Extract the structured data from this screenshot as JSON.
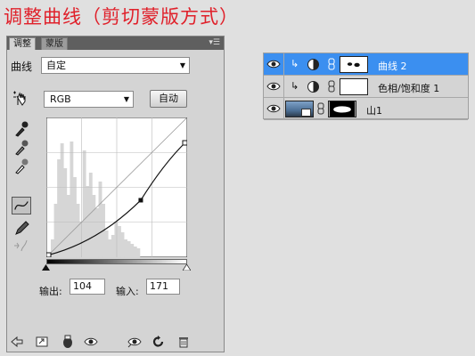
{
  "heading": "调整曲线（剪切蒙版方式）",
  "adjustments_panel": {
    "tabs": [
      {
        "label": "调整"
      },
      {
        "label": "蒙版"
      }
    ],
    "menu_icon": "panel-menu-icon",
    "preset_label": "曲线",
    "preset_value": "自定",
    "channel_value": "RGB",
    "auto_label": "自动",
    "output_label": "输出:",
    "output_value": "104",
    "input_label": "输入:",
    "input_value": "171",
    "curve_point": {
      "input": 171,
      "output": 104
    },
    "tools": [
      "targeted-adjustment-icon",
      "black-point-eyedropper-icon",
      "gray-point-eyedropper-icon",
      "white-point-eyedropper-icon",
      "curve-tool-icon",
      "pencil-tool-icon",
      "smooth-icon"
    ],
    "bottom_icons": [
      "back-arrow-icon",
      "expand-view-icon",
      "clip-to-layer-icon",
      "visibility-eye-icon",
      "view-previous-icon",
      "reset-icon",
      "trash-icon"
    ]
  },
  "layers_panel": {
    "layers": [
      {
        "name": "曲线 2",
        "selected": true,
        "type": "curves-adjustment"
      },
      {
        "name": "色相/饱和度 1",
        "selected": false,
        "type": "hue-saturation-adjustment"
      },
      {
        "name": "山1",
        "selected": false,
        "type": "image"
      }
    ]
  },
  "colors": {
    "heading": "#e0202a",
    "selected_layer": "#3b8ff0",
    "panel_bg": "#d4d4d4"
  }
}
